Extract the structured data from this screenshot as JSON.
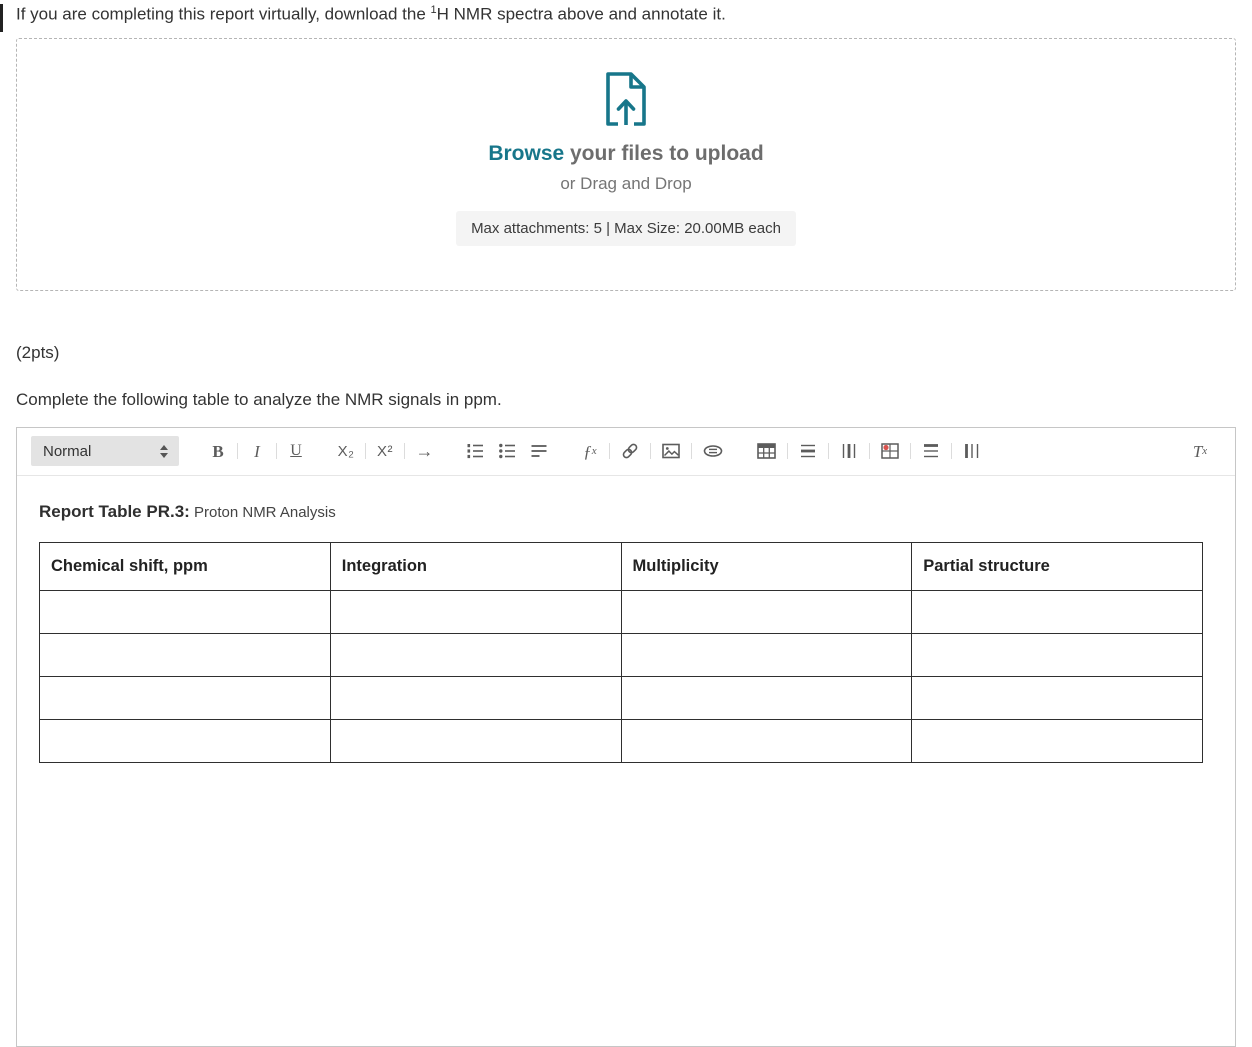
{
  "intro": {
    "prefix": "If you are completing this report virtually, download the ",
    "sup": "1",
    "suffix": "H NMR spectra above and annotate it."
  },
  "upload": {
    "browse": "Browse",
    "browse_rest": " your files to upload",
    "drag_drop": "or Drag and Drop",
    "limits": "Max attachments: 5 | Max Size: 20.00MB each"
  },
  "points": "(2pts)",
  "instruction": "Complete the following table to analyze the NMR signals in ppm.",
  "editor": {
    "toolbar": {
      "format": "Normal",
      "bold": "B",
      "italic": "I",
      "underline": "U",
      "subscript": "X₂",
      "superscript": "X²",
      "arrow": "→",
      "math_base": "ƒ",
      "math_sub": "x",
      "remove_base": "T",
      "remove_sub": "x"
    },
    "content": {
      "title_bold": "Report Table PR.3:",
      "title_rest": " Proton NMR Analysis",
      "table": {
        "headers": [
          "Chemical shift, ppm",
          "Integration",
          "Multiplicity",
          "Partial structure"
        ],
        "empty_rows": 4
      }
    }
  },
  "colors": {
    "accent_teal": "#17768a",
    "toolbar_icon_gray": "#5c5c5c",
    "danger_dot": "#d9534f"
  }
}
